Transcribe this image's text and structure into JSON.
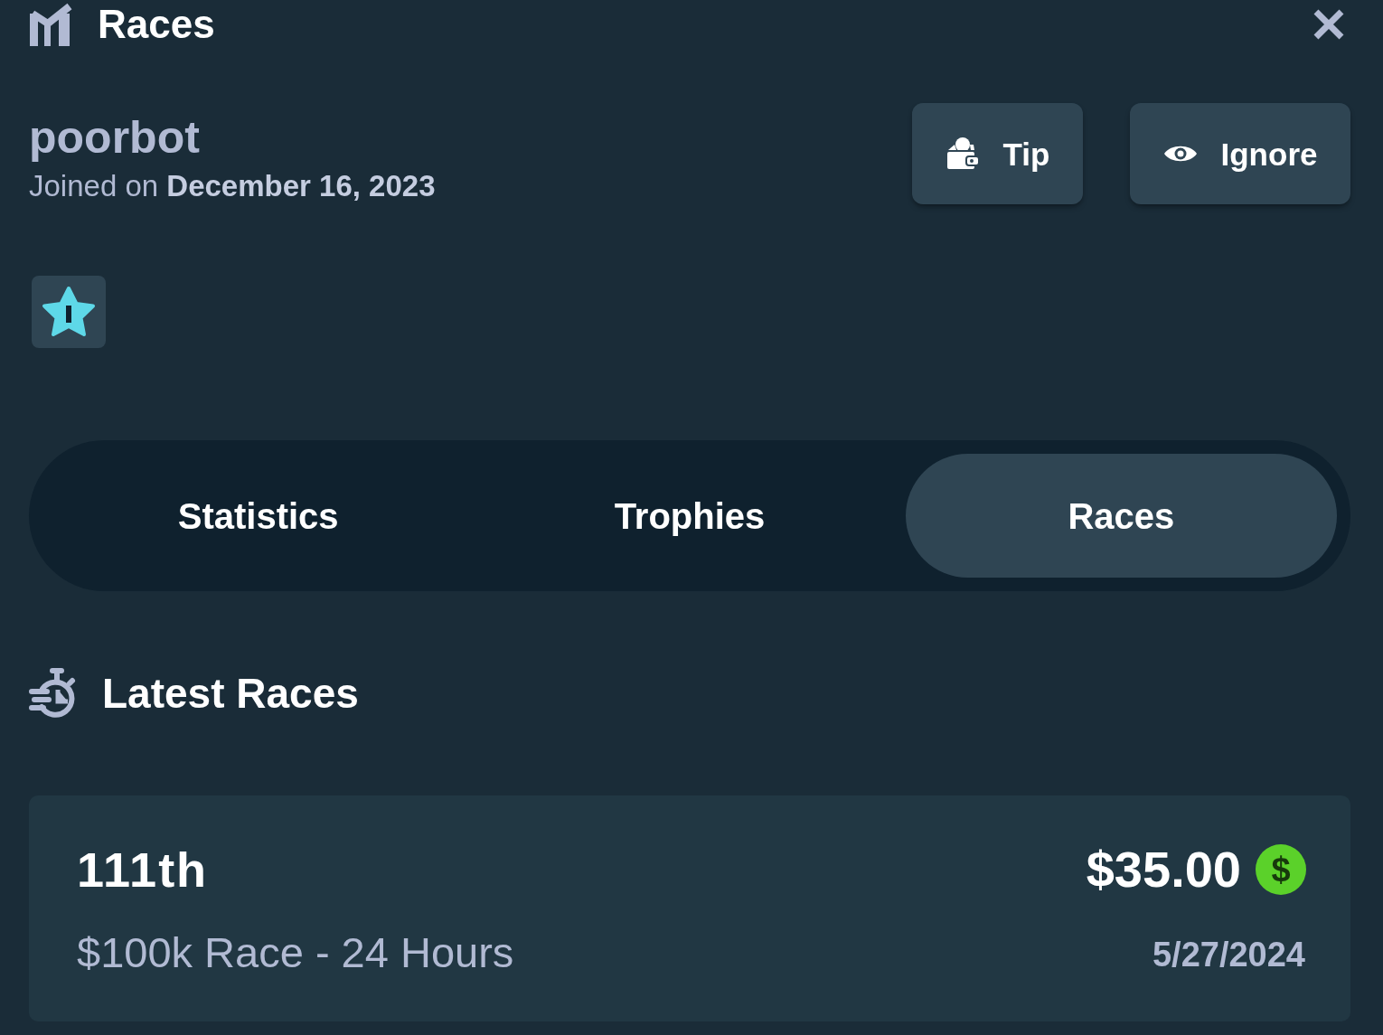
{
  "header": {
    "title": "Races"
  },
  "profile": {
    "username": "poorbot",
    "joined": "Joined on **December 16, 2023**"
  },
  "actions": [
    {
      "label": "Tip",
      "kind": "tip"
    },
    {
      "label": "Ignore",
      "kind": "ignore"
    }
  ],
  "tabs": [
    {
      "label": "Statistics",
      "selected": false
    },
    {
      "label": "Trophies",
      "selected": false
    },
    {
      "label": "Races",
      "selected": true
    }
  ],
  "latest_races": {
    "title": "Latest Races",
    "races": [
      {
        "place": "111th",
        "prize": "$35.00",
        "currency_symbol": "$",
        "name": "$100k Race - 24 Hours",
        "date": "5/27/2024"
      }
    ]
  }
}
